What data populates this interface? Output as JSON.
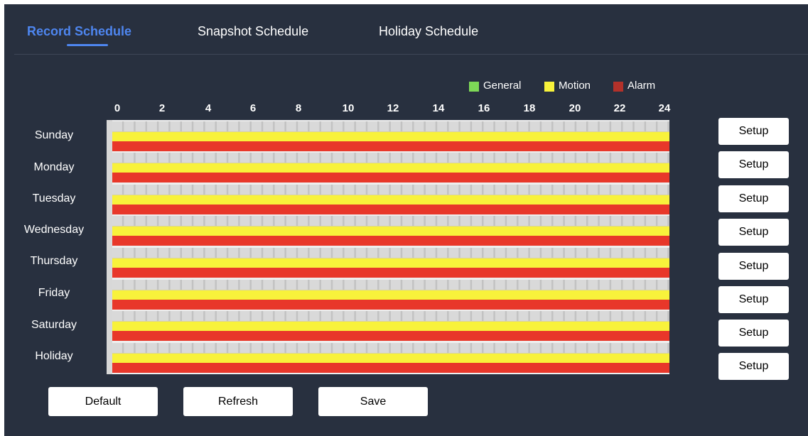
{
  "tabs": [
    {
      "label": "Record Schedule",
      "active": true
    },
    {
      "label": "Snapshot Schedule",
      "active": false
    },
    {
      "label": "Holiday Schedule",
      "active": false
    }
  ],
  "legend": [
    {
      "label": "General",
      "color": "#7ed957"
    },
    {
      "label": "Motion",
      "color": "#f8f23b"
    },
    {
      "label": "Alarm",
      "color": "#b3312a"
    }
  ],
  "hours": [
    "0",
    "2",
    "4",
    "6",
    "8",
    "10",
    "12",
    "14",
    "16",
    "18",
    "20",
    "22",
    "24"
  ],
  "days": [
    "Sunday",
    "Monday",
    "Tuesday",
    "Wednesday",
    "Thursday",
    "Friday",
    "Saturday",
    "Holiday"
  ],
  "setup_label": "Setup",
  "buttons": {
    "default_label": "Default",
    "refresh_label": "Refresh",
    "save_label": "Save"
  },
  "colors": {
    "accent": "#4e86f0",
    "background": "#28303f",
    "motion": "#f8f23b",
    "alarm": "#e8372a"
  }
}
